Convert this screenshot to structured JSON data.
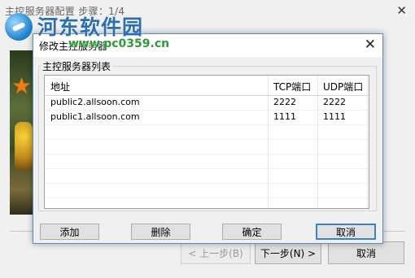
{
  "outer_window": {
    "title": "主控服务器配置 步骤：1/4",
    "close_glyph": "✕",
    "buttons": {
      "prev": "< 上一步(B)",
      "next": "下一步(N) >",
      "cancel": "取消"
    }
  },
  "watermark": {
    "title": "河东软件园",
    "url": "www.pc0359.cn"
  },
  "dialog": {
    "title": "修改主控服务器",
    "close_glyph": "✕",
    "group_label": "主控服务器列表",
    "table": {
      "columns": [
        "地址",
        "TCP端口",
        "UDP端口"
      ],
      "rows": [
        [
          "public2.allsoon.com",
          "2222",
          "2222"
        ],
        [
          "public1.allsoon.com",
          "1111",
          "1111"
        ]
      ]
    },
    "buttons": {
      "add": "添加",
      "delete": "删除",
      "ok": "确定",
      "cancel": "取消"
    }
  },
  "colors": {
    "accent_border": "#3a84c6",
    "watermark_title": "#2c6fb0",
    "watermark_url": "#2e9a3a"
  }
}
